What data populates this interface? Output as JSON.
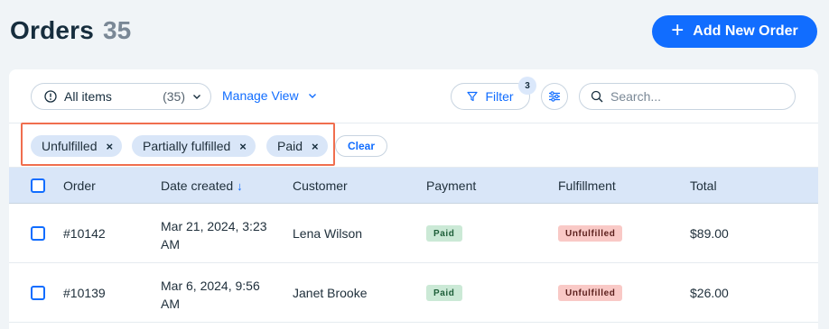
{
  "header": {
    "title": "Orders",
    "count": "35",
    "add_button_label": "Add New Order"
  },
  "toolbar": {
    "view_label": "All items",
    "view_count": "(35)",
    "manage_view_label": "Manage View",
    "filter_label": "Filter",
    "filter_count": "3",
    "search_placeholder": "Search..."
  },
  "active_filters": {
    "chips": [
      {
        "label": "Unfulfilled"
      },
      {
        "label": "Partially fulfilled"
      },
      {
        "label": "Paid"
      }
    ],
    "clear_label": "Clear"
  },
  "table": {
    "columns": [
      "Order",
      "Date created",
      "Customer",
      "Payment",
      "Fulfillment",
      "Total"
    ],
    "sorted_column": "Date created",
    "sort_icon": "arrow-down-icon",
    "rows": [
      {
        "order": "#10142",
        "date_line1": "Mar 21, 2024, 3:23",
        "date_line2": "AM",
        "customer": "Lena Wilson",
        "payment": "Paid",
        "fulfillment": "Unfulfilled",
        "total": "$89.00"
      },
      {
        "order": "#10139",
        "date_line1": "Mar 6, 2024, 9:56",
        "date_line2": "AM",
        "customer": "Janet Brooke",
        "payment": "Paid",
        "fulfillment": "Unfulfilled",
        "total": "$26.00"
      }
    ]
  },
  "colors": {
    "accent": "#116dff",
    "highlight": "#f06e4e",
    "paid_bg": "#cbe9d6",
    "unfulfilled_bg": "#f9c9c6",
    "header_row_bg": "#d9e6f8"
  },
  "icons": [
    "plus-icon",
    "info-icon",
    "chevron-down-icon",
    "filter-icon",
    "sliders-icon",
    "search-icon",
    "close-icon",
    "arrow-down-icon"
  ]
}
